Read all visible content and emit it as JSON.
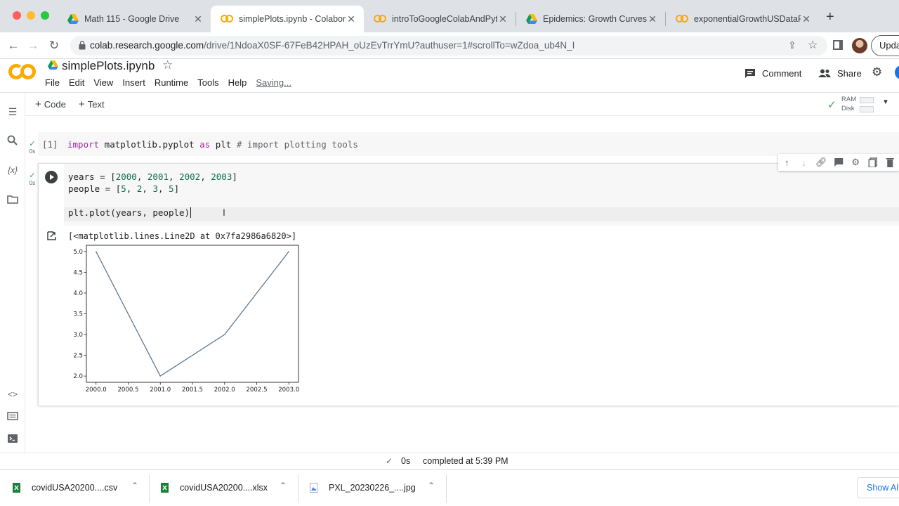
{
  "browser": {
    "tabs": [
      {
        "title": "Math 115 - Google Drive",
        "favicon": "google-drive-icon"
      },
      {
        "title": "simplePlots.ipynb - Colaboratory",
        "favicon": "colab-icon",
        "active": true
      },
      {
        "title": "introToGoogleColabAndPython",
        "favicon": "colab-icon"
      },
      {
        "title": "Epidemics: Growth Curves - Google",
        "favicon": "google-drive-icon"
      },
      {
        "title": "exponentialGrowthUSDataPython",
        "favicon": "colab-icon"
      }
    ],
    "new_tab": "+",
    "url_host": "colab.research.google.com",
    "url_path": "/drive/1NdoaX0SF-67FeB42HPAH_oUzEvTrrYmU?authuser=1#scrollTo=wZdoa_ub4N_I",
    "update_label": "Update"
  },
  "colab": {
    "notebook_title": "simplePlots.ipynb",
    "menu": [
      "File",
      "Edit",
      "View",
      "Insert",
      "Runtime",
      "Tools",
      "Help"
    ],
    "saving": "Saving...",
    "comment_label": "Comment",
    "share_label": "Share",
    "add_code": "Code",
    "add_text": "Text",
    "ram_label": "RAM",
    "disk_label": "Disk"
  },
  "cells": {
    "cell1": {
      "prompt": "[1]",
      "exec_time": "0s",
      "code": {
        "kw1": "import",
        "mid": " matplotlib.pyplot ",
        "kw2": "as",
        "rest": " plt ",
        "comment": "# import plotting tools"
      }
    },
    "cell2": {
      "exec_time": "0s",
      "line1": {
        "a": "years = [",
        "n1": "2000",
        "s1": ", ",
        "n2": "2001",
        "s2": ", ",
        "n3": "2002",
        "s3": ", ",
        "n4": "2003",
        "end": "]"
      },
      "line2": {
        "a": "people = [",
        "n1": "5",
        "s1": ", ",
        "n2": "2",
        "s2": ", ",
        "n3": "3",
        "s3": ", ",
        "n4": "5",
        "end": "]"
      },
      "line3": "plt.plot(years, people)",
      "output_text": "[<matplotlib.lines.Line2D at 0x7fa2986a6820>]"
    }
  },
  "chart_data": {
    "type": "line",
    "x": [
      2000,
      2001,
      2002,
      2003
    ],
    "series": [
      {
        "values": [
          5,
          2,
          3,
          5
        ],
        "color": "#5b7a93"
      }
    ],
    "xticks": [
      "2000.0",
      "2000.5",
      "2001.0",
      "2001.5",
      "2002.0",
      "2002.5",
      "2003.0"
    ],
    "yticks": [
      "2.0",
      "2.5",
      "3.0",
      "3.5",
      "4.0",
      "4.5",
      "5.0"
    ],
    "xlim": [
      1999.85,
      2003.15
    ],
    "ylim": [
      1.85,
      5.15
    ],
    "title": "",
    "xlabel": "",
    "ylabel": "",
    "grid": false
  },
  "status": {
    "duration": "0s",
    "message": "completed at 5:39 PM"
  },
  "downloads": {
    "items": [
      {
        "name": "covidUSA20200....csv",
        "type": "csv"
      },
      {
        "name": "covidUSA20200....xlsx",
        "type": "xlsx"
      },
      {
        "name": "PXL_20230226_....jpg",
        "type": "jpg"
      }
    ],
    "show_all": "Show All"
  },
  "colors": {
    "colab_orange": "#f9ab00",
    "check_green": "#34a853",
    "link_blue": "#1a73e8"
  }
}
